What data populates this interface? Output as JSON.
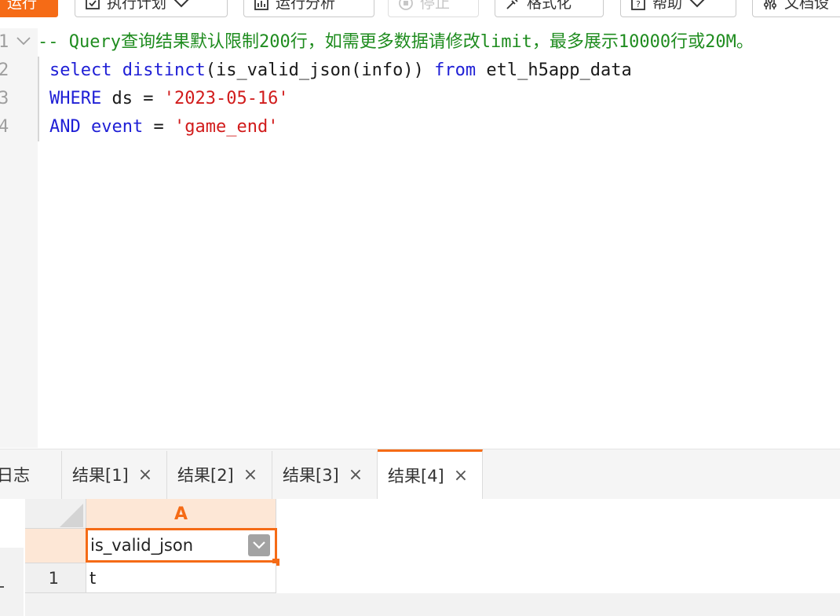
{
  "toolbar": {
    "run": "运行",
    "plan": "执行计划",
    "analyze": "运行分析",
    "stop": "停止",
    "format": "格式化",
    "help": "帮助",
    "docs": "文档设"
  },
  "editor": {
    "line_numbers": [
      "1",
      "2",
      "3",
      "4"
    ],
    "lines": {
      "l1": {
        "comment": "-- Query查询结果默认限制200行，如需更多数据请修改limit，最多展示10000行或20M。"
      },
      "l2": {
        "k1": "select",
        "k2": "distinct",
        "t1": "(is_valid_json(info))",
        "k3": "from",
        "t2": "etl_h5app_data"
      },
      "l3": {
        "k1": "WHERE",
        "t1": "ds",
        "op": "=",
        "s1": "'2023-05-16'"
      },
      "l4": {
        "k1": "AND",
        "k2": "event",
        "op": "=",
        "s1": "'game_end'"
      }
    }
  },
  "tabs": {
    "log": "日志",
    "items": [
      {
        "label": "结果[1]",
        "close": "×"
      },
      {
        "label": "结果[2]",
        "close": "×"
      },
      {
        "label": "结果[3]",
        "close": "×"
      },
      {
        "label": "结果[4]",
        "close": "×"
      }
    ],
    "active_index": 3
  },
  "grid": {
    "column_letter": "A",
    "column_header": "is_valid_json",
    "rows": [
      {
        "index": "1",
        "value": "t"
      }
    ]
  },
  "colors": {
    "accent": "#f56b16",
    "keyword": "#1f1fd6",
    "string": "#d11b1b",
    "comment": "#1f8c1f"
  }
}
